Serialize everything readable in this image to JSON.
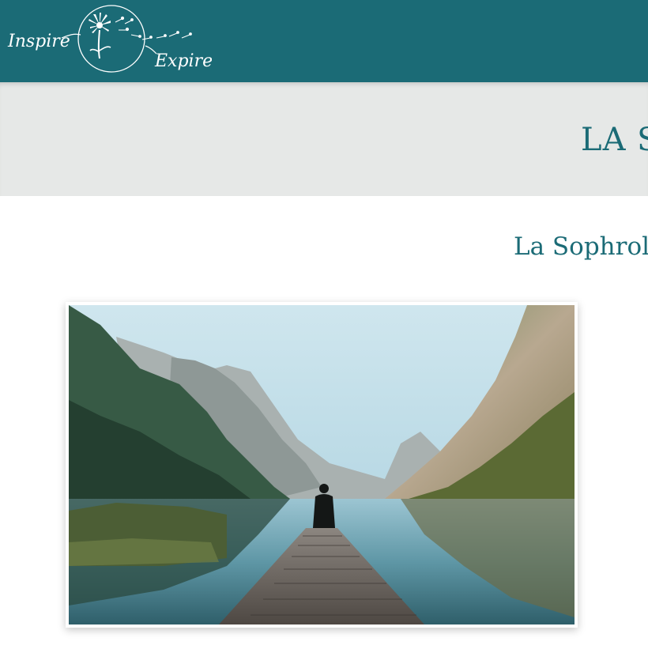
{
  "header": {
    "background_color": "#1b6b76",
    "logo": {
      "word_left": "Inspire",
      "word_right": "Expire",
      "icon": "dandelion-icon"
    }
  },
  "hero_band": {
    "background_color": "#e6e8e7",
    "title": "LA SO"
  },
  "main": {
    "subtitle": "La Sophrolo",
    "image": {
      "icon": "lake-mountain-dock-photo"
    }
  },
  "colors": {
    "accent": "#1b6b76",
    "band": "#e6e8e7",
    "white": "#ffffff"
  }
}
